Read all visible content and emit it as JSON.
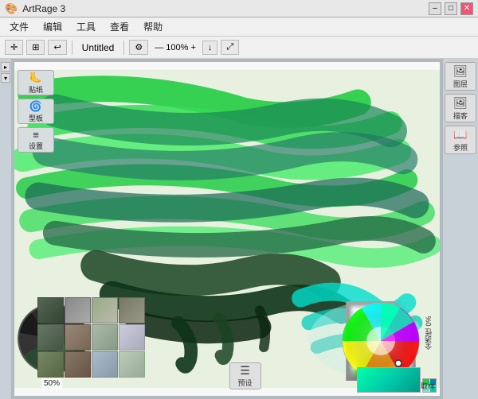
{
  "titlebar": {
    "app_name": "ArtRage 3",
    "logo": "🎨",
    "min_label": "–",
    "max_label": "□",
    "close_label": "✕"
  },
  "menubar": {
    "items": [
      "文件",
      "编辑",
      "工具",
      "查看",
      "帮助"
    ]
  },
  "toolbar": {
    "move_icon": "✛",
    "grid_icon": "⊞",
    "undo_icon": "↩",
    "redo_icon": "↪",
    "doc_title": "Untitled",
    "settings_icon": "⚙",
    "zoom_label": "— 100% +",
    "export_icon": "↓",
    "expand_icon": "⤢"
  },
  "left_sidebar": {
    "buttons": [
      {
        "id": "sticker",
        "icon": "🦶",
        "label": "贴纸"
      },
      {
        "id": "template",
        "icon": "🌀",
        "label": "型板"
      },
      {
        "id": "settings",
        "icon": "≡",
        "label": "设置"
      }
    ]
  },
  "right_panel": {
    "buttons": [
      {
        "id": "layers",
        "icon": "🖼",
        "label": "图层"
      },
      {
        "id": "refs",
        "icon": "🖼",
        "label": "描客"
      },
      {
        "id": "ref2",
        "icon": "📖",
        "label": "参照"
      }
    ]
  },
  "bottom": {
    "preview_label": "预设",
    "sample_label": "取样",
    "percent_label": "50%",
    "opacity_label": "全透性 0%"
  },
  "colors": {
    "canvas_bg": "#f5f8f0",
    "bg_chrome": "#c8d0d8"
  }
}
